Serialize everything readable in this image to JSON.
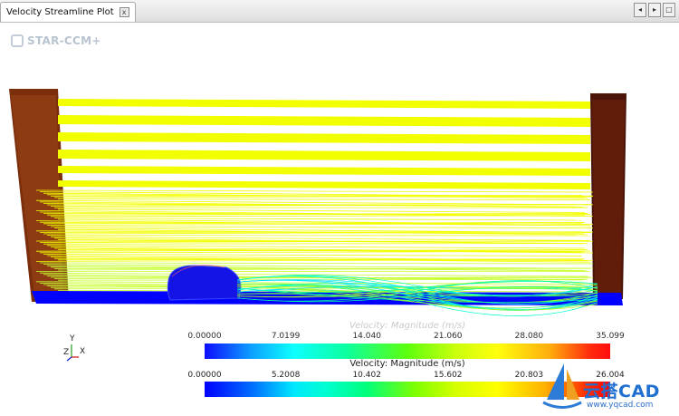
{
  "tab": {
    "title": "Velocity Streamline Plot",
    "close_glyph": "x"
  },
  "window_buttons": [
    "◂",
    "▸",
    "□"
  ],
  "viewport": {
    "logo_text": "STAR-CCM+",
    "scalar_bars": [
      {
        "title": "Velocity: Magnitude (m/s)",
        "ticks": [
          "0.00000",
          "7.0199",
          "14.040",
          "21.060",
          "28.080",
          "35.099"
        ],
        "range": [
          0.0,
          35.099
        ]
      },
      {
        "title": "Velocity: Magnitude (m/s)",
        "ticks": [
          "0.00000",
          "5.2008",
          "10.402",
          "15.602",
          "20.803",
          "26.004"
        ],
        "range": [
          0.0,
          26.004
        ]
      }
    ],
    "triad": {
      "y": "Y",
      "z": "Z",
      "x": "X"
    }
  },
  "watermark": {
    "text": "云搭CAD",
    "url": "www.yqcad.com"
  },
  "colors": {
    "streamline": "#f2ff00",
    "ground": "#0000ff",
    "body": "#1010e0",
    "wall": "#8a3510"
  }
}
